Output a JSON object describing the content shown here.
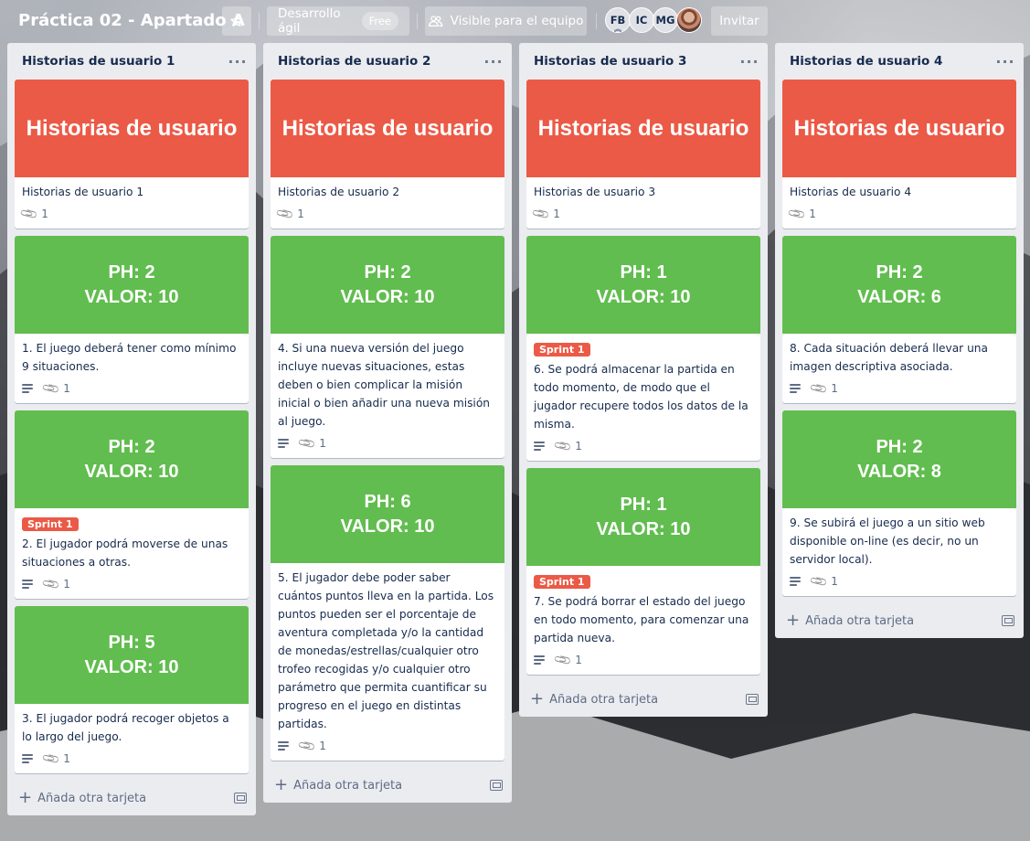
{
  "header": {
    "board_title": "Práctica 02 - Apartado A",
    "team_label": "Desarrollo ágil",
    "team_badge": "Free",
    "visibility_label": "Visible para el equipo",
    "members": [
      "FB",
      "IC",
      "MG"
    ],
    "invite_label": "Invitar"
  },
  "lists": [
    {
      "title": "Historias de usuario 1",
      "cards": [
        {
          "cover_lines": [
            "Historias de usuario"
          ],
          "cover_color": "#eb5a46",
          "label": "",
          "text": "Historias de usuario 1",
          "has_description": false,
          "attachments": "1"
        },
        {
          "cover_lines": [
            "PH: 2",
            "VALOR: 10"
          ],
          "cover_color": "#61bd4f",
          "label": "",
          "text": "1. El juego deberá tener como mínimo 9 situaciones.",
          "has_description": true,
          "attachments": "1"
        },
        {
          "cover_lines": [
            "PH: 2",
            "VALOR: 10"
          ],
          "cover_color": "#61bd4f",
          "label": "Sprint 1",
          "text": "2. El jugador podrá moverse de unas situaciones a otras.",
          "has_description": true,
          "attachments": "1"
        },
        {
          "cover_lines": [
            "PH: 5",
            "VALOR: 10"
          ],
          "cover_color": "#61bd4f",
          "label": "",
          "text": "3. El jugador podrá recoger objetos a lo largo del juego.",
          "has_description": true,
          "attachments": "1"
        }
      ],
      "add_card_label": "Añada otra tarjeta"
    },
    {
      "title": "Historias de usuario 2",
      "cards": [
        {
          "cover_lines": [
            "Historias de usuario"
          ],
          "cover_color": "#eb5a46",
          "label": "",
          "text": "Historias de usuario 2",
          "has_description": false,
          "attachments": "1"
        },
        {
          "cover_lines": [
            "PH: 2",
            "VALOR: 10"
          ],
          "cover_color": "#61bd4f",
          "label": "",
          "text": "4. Si una nueva versión del juego incluye nuevas situaciones, estas deben o bien complicar la misión inicial o bien añadir una nueva misión al juego.",
          "has_description": true,
          "attachments": "1"
        },
        {
          "cover_lines": [
            "PH: 6",
            "VALOR: 10"
          ],
          "cover_color": "#61bd4f",
          "label": "",
          "text": "5. El jugador debe poder saber cuántos puntos lleva en la partida. Los puntos pueden ser el porcentaje de aventura completada y/o la cantidad de monedas/estrellas/cualquier otro trofeo recogidas y/o cualquier otro parámetro que permita cuantificar su progreso en el juego en distintas partidas.",
          "has_description": true,
          "attachments": "1"
        }
      ],
      "add_card_label": "Añada otra tarjeta"
    },
    {
      "title": "Historias de usuario 3",
      "cards": [
        {
          "cover_lines": [
            "Historias de usuario"
          ],
          "cover_color": "#eb5a46",
          "label": "",
          "text": "Historias de usuario 3",
          "has_description": false,
          "attachments": "1"
        },
        {
          "cover_lines": [
            "PH: 1",
            "VALOR: 10"
          ],
          "cover_color": "#61bd4f",
          "label": "Sprint 1",
          "text": "6. Se podrá almacenar la partida en todo momento, de modo que el jugador recupere todos los datos de la misma.",
          "has_description": true,
          "attachments": "1"
        },
        {
          "cover_lines": [
            "PH: 1",
            "VALOR: 10"
          ],
          "cover_color": "#61bd4f",
          "label": "Sprint 1",
          "text": "7. Se podrá borrar el estado del juego en todo momento, para comenzar una partida nueva.",
          "has_description": true,
          "attachments": "1"
        }
      ],
      "add_card_label": "Añada otra tarjeta"
    },
    {
      "title": "Historias de usuario 4",
      "cards": [
        {
          "cover_lines": [
            "Historias de usuario"
          ],
          "cover_color": "#eb5a46",
          "label": "",
          "text": "Historias de usuario 4",
          "has_description": false,
          "attachments": "1"
        },
        {
          "cover_lines": [
            "PH: 2",
            "VALOR: 6"
          ],
          "cover_color": "#61bd4f",
          "label": "",
          "text": "8. Cada situación deberá llevar una imagen descriptiva asociada.",
          "has_description": true,
          "attachments": "1"
        },
        {
          "cover_lines": [
            "PH: 2",
            "VALOR: 8"
          ],
          "cover_color": "#61bd4f",
          "label": "",
          "text": "9. Se subirá el juego a un sitio web disponible on-line (es decir, no un servidor local).",
          "has_description": true,
          "attachments": "1"
        }
      ],
      "add_card_label": "Añada otra tarjeta"
    }
  ],
  "icons": {
    "star": "star-icon",
    "visibility": "team-visibility-icon",
    "list_menu": "more-horizontal-icon",
    "description": "description-icon",
    "attachment": "paperclip-icon",
    "add": "plus-icon",
    "template": "card-template-icon"
  },
  "colors": {
    "red_cover": "#eb5a46",
    "green_cover": "#61bd4f",
    "list_bg": "#ebecf0",
    "label_red": "#eb5a46"
  }
}
